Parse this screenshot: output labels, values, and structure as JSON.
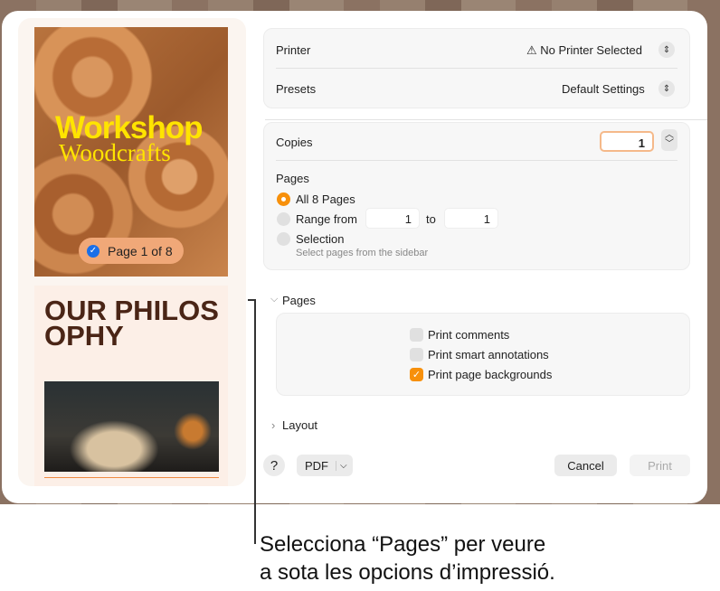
{
  "sidebar": {
    "page1": {
      "title1": "Workshop",
      "title2": "Woodcrafts",
      "badge": "Page 1 of 8"
    },
    "page2": {
      "heading": "OUR PHILOSOPHY"
    }
  },
  "printer": {
    "label": "Printer",
    "value": "No Printer Selected"
  },
  "presets": {
    "label": "Presets",
    "value": "Default Settings"
  },
  "copies": {
    "label": "Copies",
    "value": "1"
  },
  "pages": {
    "label": "Pages",
    "all": "All 8 Pages",
    "range": "Range from",
    "from": "1",
    "to_label": "to",
    "to": "1",
    "selection": "Selection",
    "selection_hint": "Select pages from the sidebar"
  },
  "pages_section": {
    "label": "Pages",
    "options": [
      {
        "label": "Print comments",
        "checked": false
      },
      {
        "label": "Print smart annotations",
        "checked": false
      },
      {
        "label": "Print page backgrounds",
        "checked": true
      }
    ]
  },
  "layout_section": {
    "label": "Layout"
  },
  "footer": {
    "help": "?",
    "pdf": "PDF",
    "cancel": "Cancel",
    "print": "Print"
  },
  "caption": {
    "line1": "Selecciona “Pages” per veure",
    "line2": "a sota les opcions d’impressió."
  },
  "colors": {
    "accent": "#f7900b",
    "check_blue": "#1a6fe8",
    "title_yellow": "#ffe400"
  }
}
